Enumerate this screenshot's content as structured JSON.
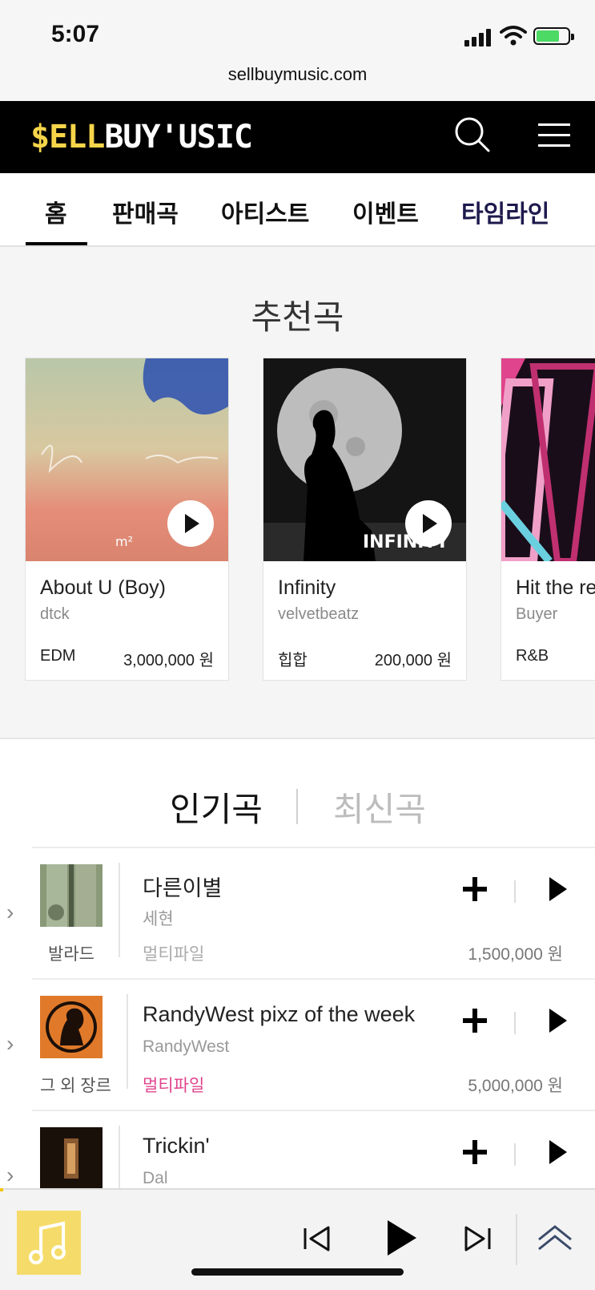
{
  "status_bar": {
    "time": "5:07",
    "url": "sellbuymusic.com"
  },
  "header": {
    "logo_accent": "$ELL",
    "logo_rest": "BUY'USIC",
    "accent_color": "#f7d54a"
  },
  "nav": {
    "tabs": [
      {
        "label": "홈",
        "active": true
      },
      {
        "label": "판매곡"
      },
      {
        "label": "아티스트"
      },
      {
        "label": "이벤트"
      },
      {
        "label": "타임라인"
      }
    ]
  },
  "recommended": {
    "title": "추천곡",
    "cards": [
      {
        "title": "About U (Boy)",
        "artist": "dtck",
        "genre": "EDM",
        "price": "3,000,000 원",
        "art_text": "m²"
      },
      {
        "title": "Infinity",
        "artist": "velvetbeatz",
        "genre": "힙합",
        "price": "200,000 원",
        "art_text": "INFINITY"
      },
      {
        "title": "Hit the re",
        "artist": "Buyer",
        "genre": "R&B",
        "price": ""
      }
    ]
  },
  "popular": {
    "tabs": [
      {
        "label": "인기곡",
        "active": true
      },
      {
        "label": "최신곡"
      }
    ],
    "rows": [
      {
        "title": "다른이별",
        "artist": "세현",
        "genre": "발라드",
        "file_type": "멀티파일",
        "file_highlight": false,
        "price": "1,500,000 원"
      },
      {
        "title": "RandyWest pixz of the week",
        "artist": "RandyWest",
        "genre": "그 외 장르",
        "file_type": "멀티파일",
        "file_highlight": true,
        "price": "5,000,000 원"
      },
      {
        "title": "Trickin'",
        "artist": "Dal",
        "genre": "",
        "file_type": "",
        "file_highlight": false,
        "price": ""
      }
    ]
  },
  "player": {
    "progress": 0.005
  },
  "colors": {
    "highlight_pink": "#e0448c",
    "timeline_tab": "#1d1a4d",
    "player_tile": "#f5dc6a"
  }
}
